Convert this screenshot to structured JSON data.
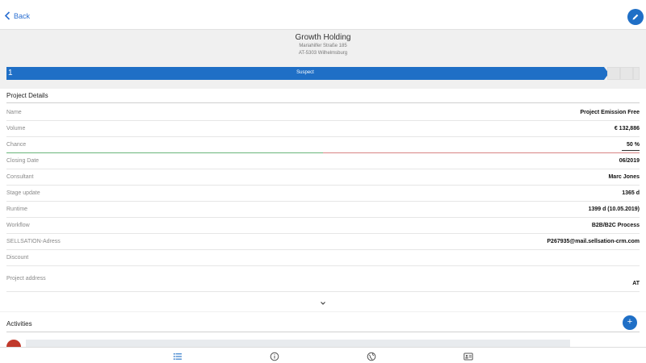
{
  "topbar": {
    "back_label": "Back"
  },
  "header": {
    "company": "Growth Holding",
    "street": "Mariahilfer Straße 185",
    "city": "AT-5303 Wilhelmsburg"
  },
  "stage": {
    "number": "1",
    "label": "Suspect",
    "progress_color": "#1f6fc6"
  },
  "details": {
    "title": "Project Details",
    "rows": [
      {
        "key": "Name",
        "value": "Project Emission Free"
      },
      {
        "key": "Volume",
        "value": "€ 132,886"
      },
      {
        "key": "Chance",
        "value": "50 %"
      },
      {
        "key": "Closing Date",
        "value": "06/2019"
      },
      {
        "key": "Consultant",
        "value": "Marc Jones"
      },
      {
        "key": "Stage update",
        "value": "1365 d"
      },
      {
        "key": "Runtime",
        "value": "1399 d (10.05.2019)"
      },
      {
        "key": "Workflow",
        "value": "B2B/B2C Process"
      },
      {
        "key": "SELLSATION-Adress",
        "value": "P267935@mail.sellsation-crm.com"
      },
      {
        "key": "Discount",
        "value": ""
      },
      {
        "key": "Project address",
        "value": "AT"
      }
    ]
  },
  "activities": {
    "title": "Activities",
    "add_label": "+"
  },
  "icons": {
    "back": "chevron-left-icon",
    "edit": "pencil-icon",
    "expand": "chevron-down-icon",
    "tabs": [
      "list-icon",
      "info-icon",
      "globe-icon",
      "contact-card-icon"
    ]
  }
}
